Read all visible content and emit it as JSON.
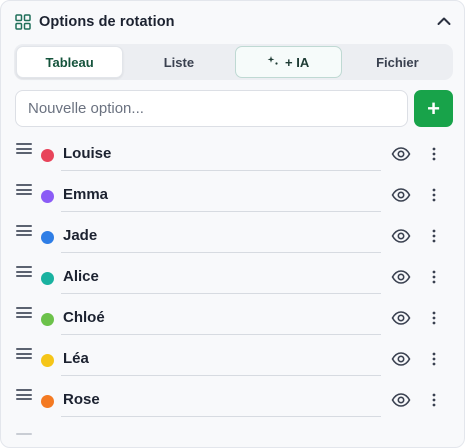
{
  "header": {
    "title": "Options de rotation",
    "grid_icon": "grid-icon",
    "collapse_icon": "chevron-up-icon"
  },
  "tabs": [
    {
      "label": "Tableau",
      "active": true
    },
    {
      "label": "Liste",
      "active": false
    },
    {
      "label": "+ IA",
      "active": false,
      "icon": "sparkle-icon"
    },
    {
      "label": "Fichier",
      "active": false
    }
  ],
  "input": {
    "placeholder": "Nouvelle option...",
    "value": ""
  },
  "add_button": {
    "label": "+"
  },
  "options": [
    {
      "name": "Louise",
      "color": "#e8445a"
    },
    {
      "name": "Emma",
      "color": "#8b5cf6"
    },
    {
      "name": "Jade",
      "color": "#2f7ee6"
    },
    {
      "name": "Alice",
      "color": "#19b2a0"
    },
    {
      "name": "Chloé",
      "color": "#6cc24a"
    },
    {
      "name": "Léa",
      "color": "#f5c518"
    },
    {
      "name": "Rose",
      "color": "#f47a22"
    }
  ],
  "colors": {
    "accent_green": "#18a34a",
    "active_tab_text": "#14533b"
  }
}
